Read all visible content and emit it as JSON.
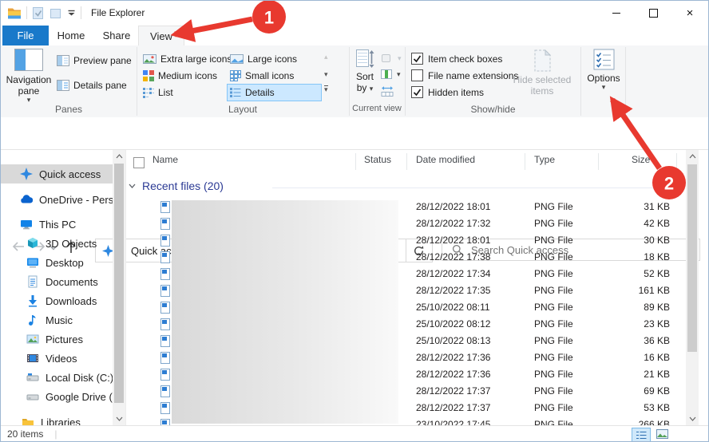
{
  "window": {
    "title": "File Explorer"
  },
  "titlebar": {
    "qat_icons": [
      "explorer-folder-icon",
      "properties-icon",
      "new-folder-icon",
      "customize-qat-dropdown-icon"
    ]
  },
  "tabs": {
    "file": "File",
    "home": "Home",
    "share": "Share",
    "view": "View",
    "active_tab": "View"
  },
  "ribbon": {
    "panes_group": {
      "label": "Panes",
      "navigation_pane": "Navigation pane",
      "preview_pane": "Preview pane",
      "details_pane": "Details pane"
    },
    "layout_group": {
      "label": "Layout",
      "extra_large": "Extra large icons",
      "large": "Large icons",
      "medium": "Medium icons",
      "small": "Small icons",
      "list": "List",
      "details": "Details",
      "selected_item": "Details"
    },
    "current_view_group": {
      "label": "Current view",
      "sort_line1": "Sort",
      "sort_line2": "by"
    },
    "show_hide_group": {
      "label": "Show/hide",
      "item_check_boxes": "Item check boxes",
      "file_name_extensions": "File name extensions",
      "hidden_items": "Hidden items",
      "item_check_boxes_checked": true,
      "file_name_extensions_checked": false,
      "hidden_items_checked": true,
      "hide_selected_line1": "Hide selected",
      "hide_selected_line2": "items"
    },
    "options": {
      "label": "Options"
    }
  },
  "address": {
    "breadcrumb": "Quick access",
    "search_placeholder": "Search Quick access"
  },
  "sidebar": {
    "items": [
      {
        "label": "Quick access",
        "icon": "quick-access-star",
        "selected": true
      },
      {
        "label": "OneDrive - Personal",
        "icon": "onedrive-cloud"
      },
      {
        "label": "This PC",
        "icon": "this-pc"
      },
      {
        "label": "3D Objects",
        "icon": "3d-objects"
      },
      {
        "label": "Desktop",
        "icon": "desktop"
      },
      {
        "label": "Documents",
        "icon": "documents"
      },
      {
        "label": "Downloads",
        "icon": "downloads"
      },
      {
        "label": "Music",
        "icon": "music"
      },
      {
        "label": "Pictures",
        "icon": "pictures"
      },
      {
        "label": "Videos",
        "icon": "videos"
      },
      {
        "label": "Local Disk (C:)",
        "icon": "local-disk"
      },
      {
        "label": "Google Drive (G:)",
        "icon": "google-drive"
      },
      {
        "label": "Libraries",
        "icon": "libraries"
      }
    ]
  },
  "files": {
    "columns": {
      "name": "Name",
      "status": "Status",
      "date_modified": "Date modified",
      "type": "Type",
      "size": "Size"
    },
    "group_header": "Recent files (20)",
    "rows": [
      {
        "date": "28/12/2022 18:01",
        "type": "PNG File",
        "size": "31 KB"
      },
      {
        "date": "28/12/2022 17:32",
        "type": "PNG File",
        "size": "42 KB"
      },
      {
        "date": "28/12/2022 18:01",
        "type": "PNG File",
        "size": "30 KB"
      },
      {
        "date": "28/12/2022 17:38",
        "type": "PNG File",
        "size": "18 KB"
      },
      {
        "date": "28/12/2022 17:34",
        "type": "PNG File",
        "size": "52 KB"
      },
      {
        "date": "28/12/2022 17:35",
        "type": "PNG File",
        "size": "161 KB"
      },
      {
        "date": "25/10/2022 08:11",
        "type": "PNG File",
        "size": "89 KB"
      },
      {
        "date": "25/10/2022 08:12",
        "type": "PNG File",
        "size": "23 KB"
      },
      {
        "date": "25/10/2022 08:13",
        "type": "PNG File",
        "size": "36 KB"
      },
      {
        "date": "28/12/2022 17:36",
        "type": "PNG File",
        "size": "16 KB"
      },
      {
        "date": "28/12/2022 17:36",
        "type": "PNG File",
        "size": "21 KB"
      },
      {
        "date": "28/12/2022 17:37",
        "type": "PNG File",
        "size": "69 KB"
      },
      {
        "date": "28/12/2022 17:37",
        "type": "PNG File",
        "size": "53 KB"
      },
      {
        "date": "23/10/2022 17:45",
        "type": "PNG File",
        "size": "266 KB"
      }
    ]
  },
  "statusbar": {
    "count": "20 items"
  },
  "annotations": {
    "step1_label": "1",
    "step2_label": "2"
  },
  "colors": {
    "accent_blue": "#1979ca",
    "selection_blue": "#cce8ff",
    "sidebar_selected_gray": "#d9d9d9",
    "annotation_red": "#e8392f",
    "group_header_blue": "#2b3a94"
  }
}
